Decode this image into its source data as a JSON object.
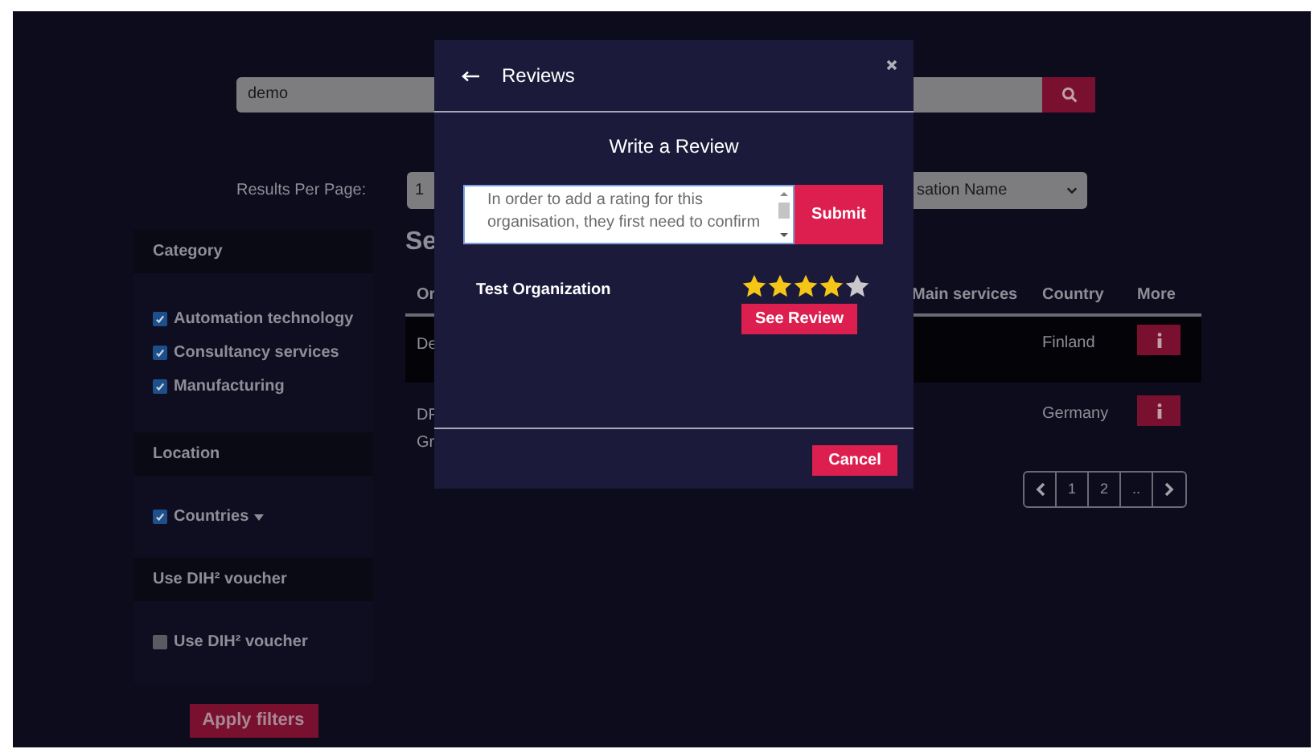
{
  "search": {
    "value": "demo"
  },
  "results_per_page": {
    "label": "Results Per Page:",
    "value": "1"
  },
  "sort_select": {
    "value": "sation Name"
  },
  "sidebar": {
    "sections": [
      {
        "title": "Category",
        "items": [
          {
            "kind": "checkbox",
            "label": "Automation technology",
            "checked": true
          },
          {
            "kind": "checkbox",
            "label": "Consultancy services",
            "checked": true
          },
          {
            "kind": "checkbox",
            "label": "Manufacturing",
            "checked": true
          }
        ]
      },
      {
        "title": "Location",
        "items": [
          {
            "kind": "dropdown",
            "label": "Countries",
            "checked": true
          }
        ]
      },
      {
        "title": "Use DIH² voucher",
        "items": [
          {
            "kind": "checkbox",
            "label": "Use DIH² voucher",
            "checked": false
          }
        ]
      }
    ],
    "apply_button": "Apply filters"
  },
  "results": {
    "heading": "Se",
    "table": {
      "columns": [
        "Or",
        "Main services",
        "Country",
        "More"
      ],
      "rows": [
        {
          "column_1": [
            "De"
          ],
          "country": "Finland",
          "highlighted": true
        },
        {
          "column_1": [
            "DF",
            "Gr"
          ],
          "country": "Germany",
          "highlighted": false
        }
      ]
    },
    "pagination": [
      "1",
      "2",
      ".."
    ]
  },
  "modal": {
    "title": "Reviews",
    "subtitle": "Write a Review",
    "review_field": {
      "value": "In order to add a rating for this organisation, they first need to confirm"
    },
    "submit_button": "Submit",
    "reviews": [
      {
        "organization": "Test Organization",
        "stars": 4,
        "button": "See Review"
      }
    ],
    "cancel_button": "Cancel"
  }
}
